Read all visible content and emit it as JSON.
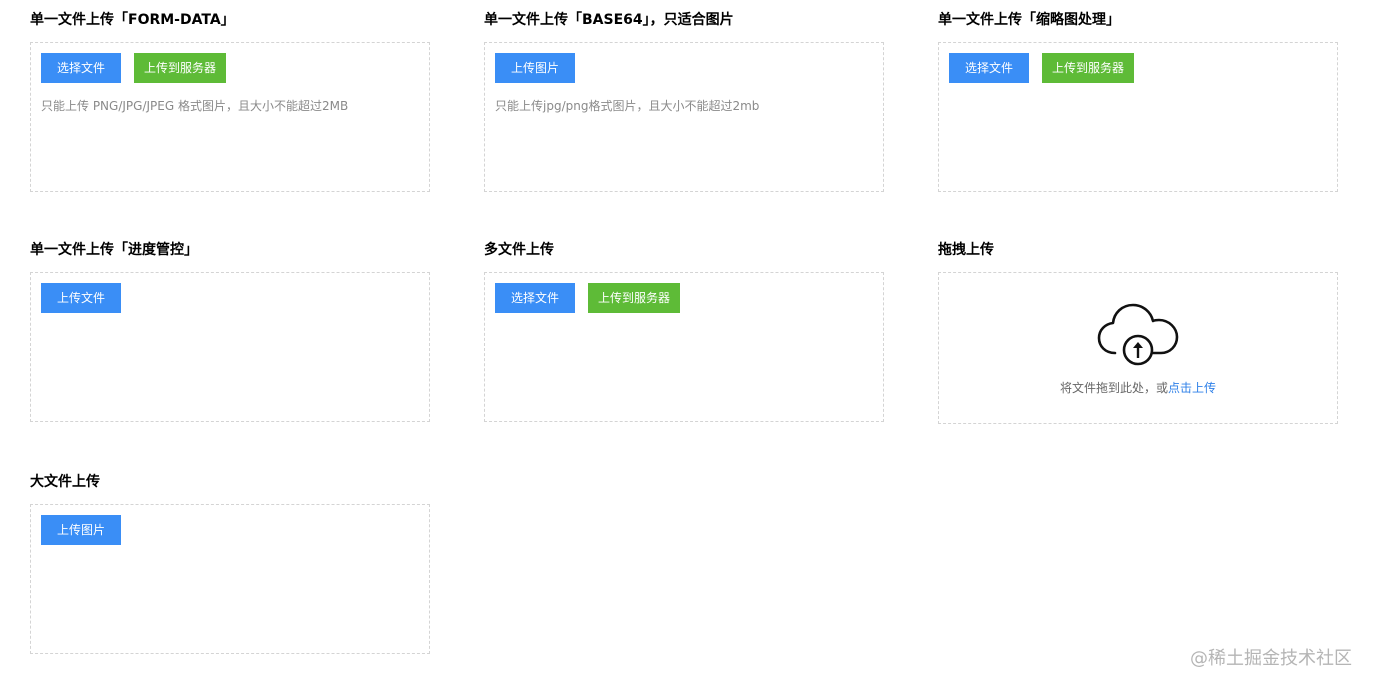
{
  "colors": {
    "primary": "#3a8ef6",
    "success": "#5ebb37",
    "link": "#2f80e8",
    "border": "#d4d4d4",
    "tip": "#8a8a8a"
  },
  "sections": {
    "formdata": {
      "title": "单一文件上传「FORM-DATA」",
      "select_label": "选择文件",
      "upload_label": "上传到服务器",
      "tip": "只能上传 PNG/JPG/JPEG 格式图片，且大小不能超过2MB"
    },
    "base64": {
      "title": "单一文件上传「BASE64」，只适合图片",
      "upload_label": "上传图片",
      "tip": "只能上传jpg/png格式图片，且大小不能超过2mb"
    },
    "thumbnail": {
      "title": "单一文件上传「缩略图处理」",
      "select_label": "选择文件",
      "upload_label": "上传到服务器"
    },
    "progress": {
      "title": "单一文件上传「进度管控」",
      "upload_label": "上传文件"
    },
    "multi": {
      "title": "多文件上传",
      "select_label": "选择文件",
      "upload_label": "上传到服务器"
    },
    "drag": {
      "title": "拖拽上传",
      "icon": "upload-cloud-icon",
      "text": "将文件拖到此处，或",
      "link": "点击上传"
    },
    "large": {
      "title": "大文件上传",
      "upload_label": "上传图片"
    }
  },
  "watermark": "@稀土掘金技术社区"
}
